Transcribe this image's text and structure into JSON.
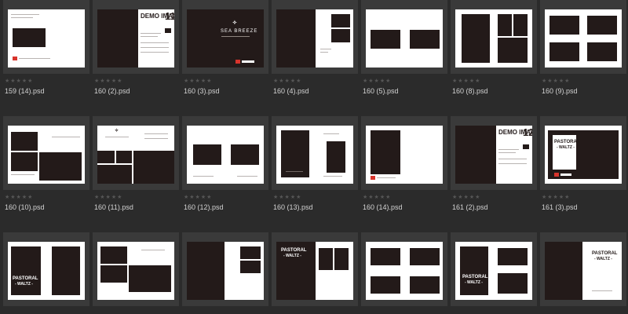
{
  "colors": {
    "background": "#2b2b2b",
    "frame": "#3a3a3a",
    "page": "#ffffff",
    "dark_block": "#231a19",
    "label": "#d2d2d2"
  },
  "rating_icon": "star-icon",
  "rating_stars": "★★★★★",
  "thumbnails": [
    {
      "filename": "159 (14).psd",
      "title": "",
      "subtitle": ""
    },
    {
      "filename": "160 (2).psd",
      "title": "DEMO IMAGE",
      "number": "11",
      "subtitle": ""
    },
    {
      "filename": "160 (3).psd",
      "title": "SEA BREEZE",
      "subtitle": ""
    },
    {
      "filename": "160 (4).psd",
      "title": "",
      "subtitle": ""
    },
    {
      "filename": "160 (5).psd",
      "title": "",
      "subtitle": ""
    },
    {
      "filename": "160 (8).psd",
      "title": "",
      "subtitle": ""
    },
    {
      "filename": "160 (9).psd",
      "title": "",
      "subtitle": ""
    },
    {
      "filename": "160 (10).psd",
      "title": "",
      "subtitle": ""
    },
    {
      "filename": "160 (11).psd",
      "title": "",
      "subtitle": ""
    },
    {
      "filename": "160 (12).psd",
      "title": "",
      "subtitle": ""
    },
    {
      "filename": "160 (13).psd",
      "title": "",
      "subtitle": ""
    },
    {
      "filename": "160 (14).psd",
      "title": "",
      "subtitle": ""
    },
    {
      "filename": "161 (2).psd",
      "title": "DEMO IMAGE",
      "number": "12",
      "subtitle": ""
    },
    {
      "filename": "161 (3).psd",
      "title": "PASTORAL",
      "subtitle": "- WALTZ -"
    },
    {
      "filename": "",
      "title": "",
      "subtitle": ""
    },
    {
      "filename": "",
      "title": "",
      "subtitle": ""
    },
    {
      "filename": "",
      "title": "",
      "subtitle": ""
    },
    {
      "filename": "",
      "title": "PASTORAL",
      "subtitle": "- WALTZ -"
    },
    {
      "filename": "",
      "title": "",
      "subtitle": ""
    },
    {
      "filename": "",
      "title": "PASTORAL",
      "subtitle": "- WALTZ -"
    },
    {
      "filename": "",
      "title": "PASTORAL",
      "subtitle": "- WALTZ -"
    }
  ]
}
